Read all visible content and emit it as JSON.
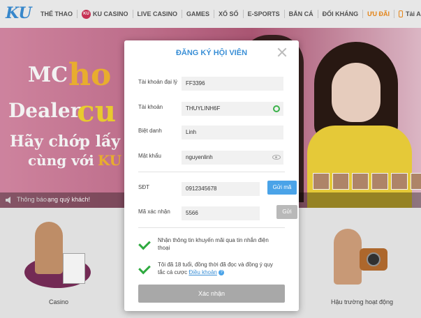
{
  "logo": {
    "text": "KU"
  },
  "nav": {
    "items": [
      "THỂ THAO",
      "KU CASINO",
      "LIVE CASINO",
      "GAMES",
      "XỔ SỐ",
      "E-SPORTS",
      "BẮN CÁ",
      "ĐỐI KHÁNG",
      "ƯU ĐÃI",
      "Tải APP"
    ],
    "ku_badge": "KU"
  },
  "banner": {
    "line1a": "MC",
    "line1b": "ho",
    "line2a": "Dealer",
    "line2b": "cu",
    "line3": "Hãy chớp lấy c",
    "line4a": "cùng với",
    "line4b": "KU"
  },
  "ticker": {
    "label": "Thông báo",
    "message": "ạng quý khách!"
  },
  "bottom": {
    "casino_label": "Casino",
    "behind_label": "Hậu trường hoạt động"
  },
  "modal": {
    "title": "ĐĂNG KÝ HỘI VIÊN",
    "fields": {
      "agent": {
        "label": "Tài khoản đại lý",
        "value": "FF3396"
      },
      "account": {
        "label": "Tài khoản",
        "value": "THUYLINH6F"
      },
      "nickname": {
        "label": "Biệt danh",
        "value": "Linh"
      },
      "password": {
        "label": "Mật khẩu",
        "value": "nguyenlinh"
      },
      "phone": {
        "label": "SĐT",
        "value": "0912345678",
        "button": "Gửi mã"
      },
      "code": {
        "label": "Mã xác nhận",
        "value": "5566",
        "button": "Gửi"
      }
    },
    "check1": "Nhận thông tin khuyến mãi qua tin nhắn điện thoại",
    "check2_pre": "Tôi đã 18 tuổi, đồng thời đã đọc và đồng ý quy tắc cá cược",
    "check2_link": "Điều khoản",
    "submit": "Xác nhận"
  },
  "colors": {
    "accent": "#3a8fd6",
    "check": "#2eaa3f",
    "active_nav": "#f08c1a"
  }
}
